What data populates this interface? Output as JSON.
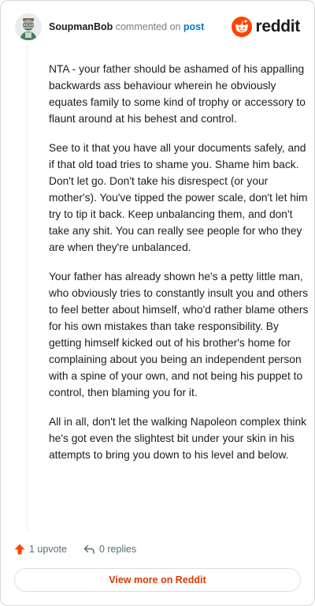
{
  "header": {
    "username": "SoupmanBob",
    "commented_text": "commented on",
    "post_link": "post",
    "brand_wordmark": "reddit"
  },
  "comment": {
    "paragraphs": [
      "NTA - your father should be ashamed of his appalling backwards ass behaviour wherein he obviously equates family to some kind of trophy or accessory to flaunt around at his behest and control.",
      "See to it that you have all your documents safely, and if that old toad tries to shame you. Shame him back. Don't let go. Don't take his disrespect (or your mother's). You've tipped the power scale, don't let him try to tip it back. Keep unbalancing them, and don't take any shit. You can really see people for who they are when they're unbalanced.",
      "Your father has already shown he's a petty little man, who obviously tries to constantly insult you and others to feel better about himself, who'd rather blame others for his own mistakes than take responsibility. By getting himself kicked out of his brother's home for complaining about you being an independent person with a spine of your own, and not being his puppet to control, then blaming you for it.",
      "All in all, don't let the walking Napoleon complex think he's got even the slightest bit under your skin in his attempts to bring you down to his level and below."
    ]
  },
  "actions": {
    "upvotes": "1 upvote",
    "replies": "0 replies",
    "view_more": "View more on Reddit"
  },
  "icons": {
    "avatar": "avatar-icon",
    "brand": "reddit-logo-icon",
    "upvote": "upvote-arrow-icon",
    "reply": "reply-arrow-icon"
  },
  "colors": {
    "brand_orange": "#ff4500",
    "upvote_orange": "#ff4500",
    "link_blue": "#0079d3",
    "view_more_text": "#d93a00",
    "meta_gray": "#576f76",
    "border": "#d3d6da"
  }
}
